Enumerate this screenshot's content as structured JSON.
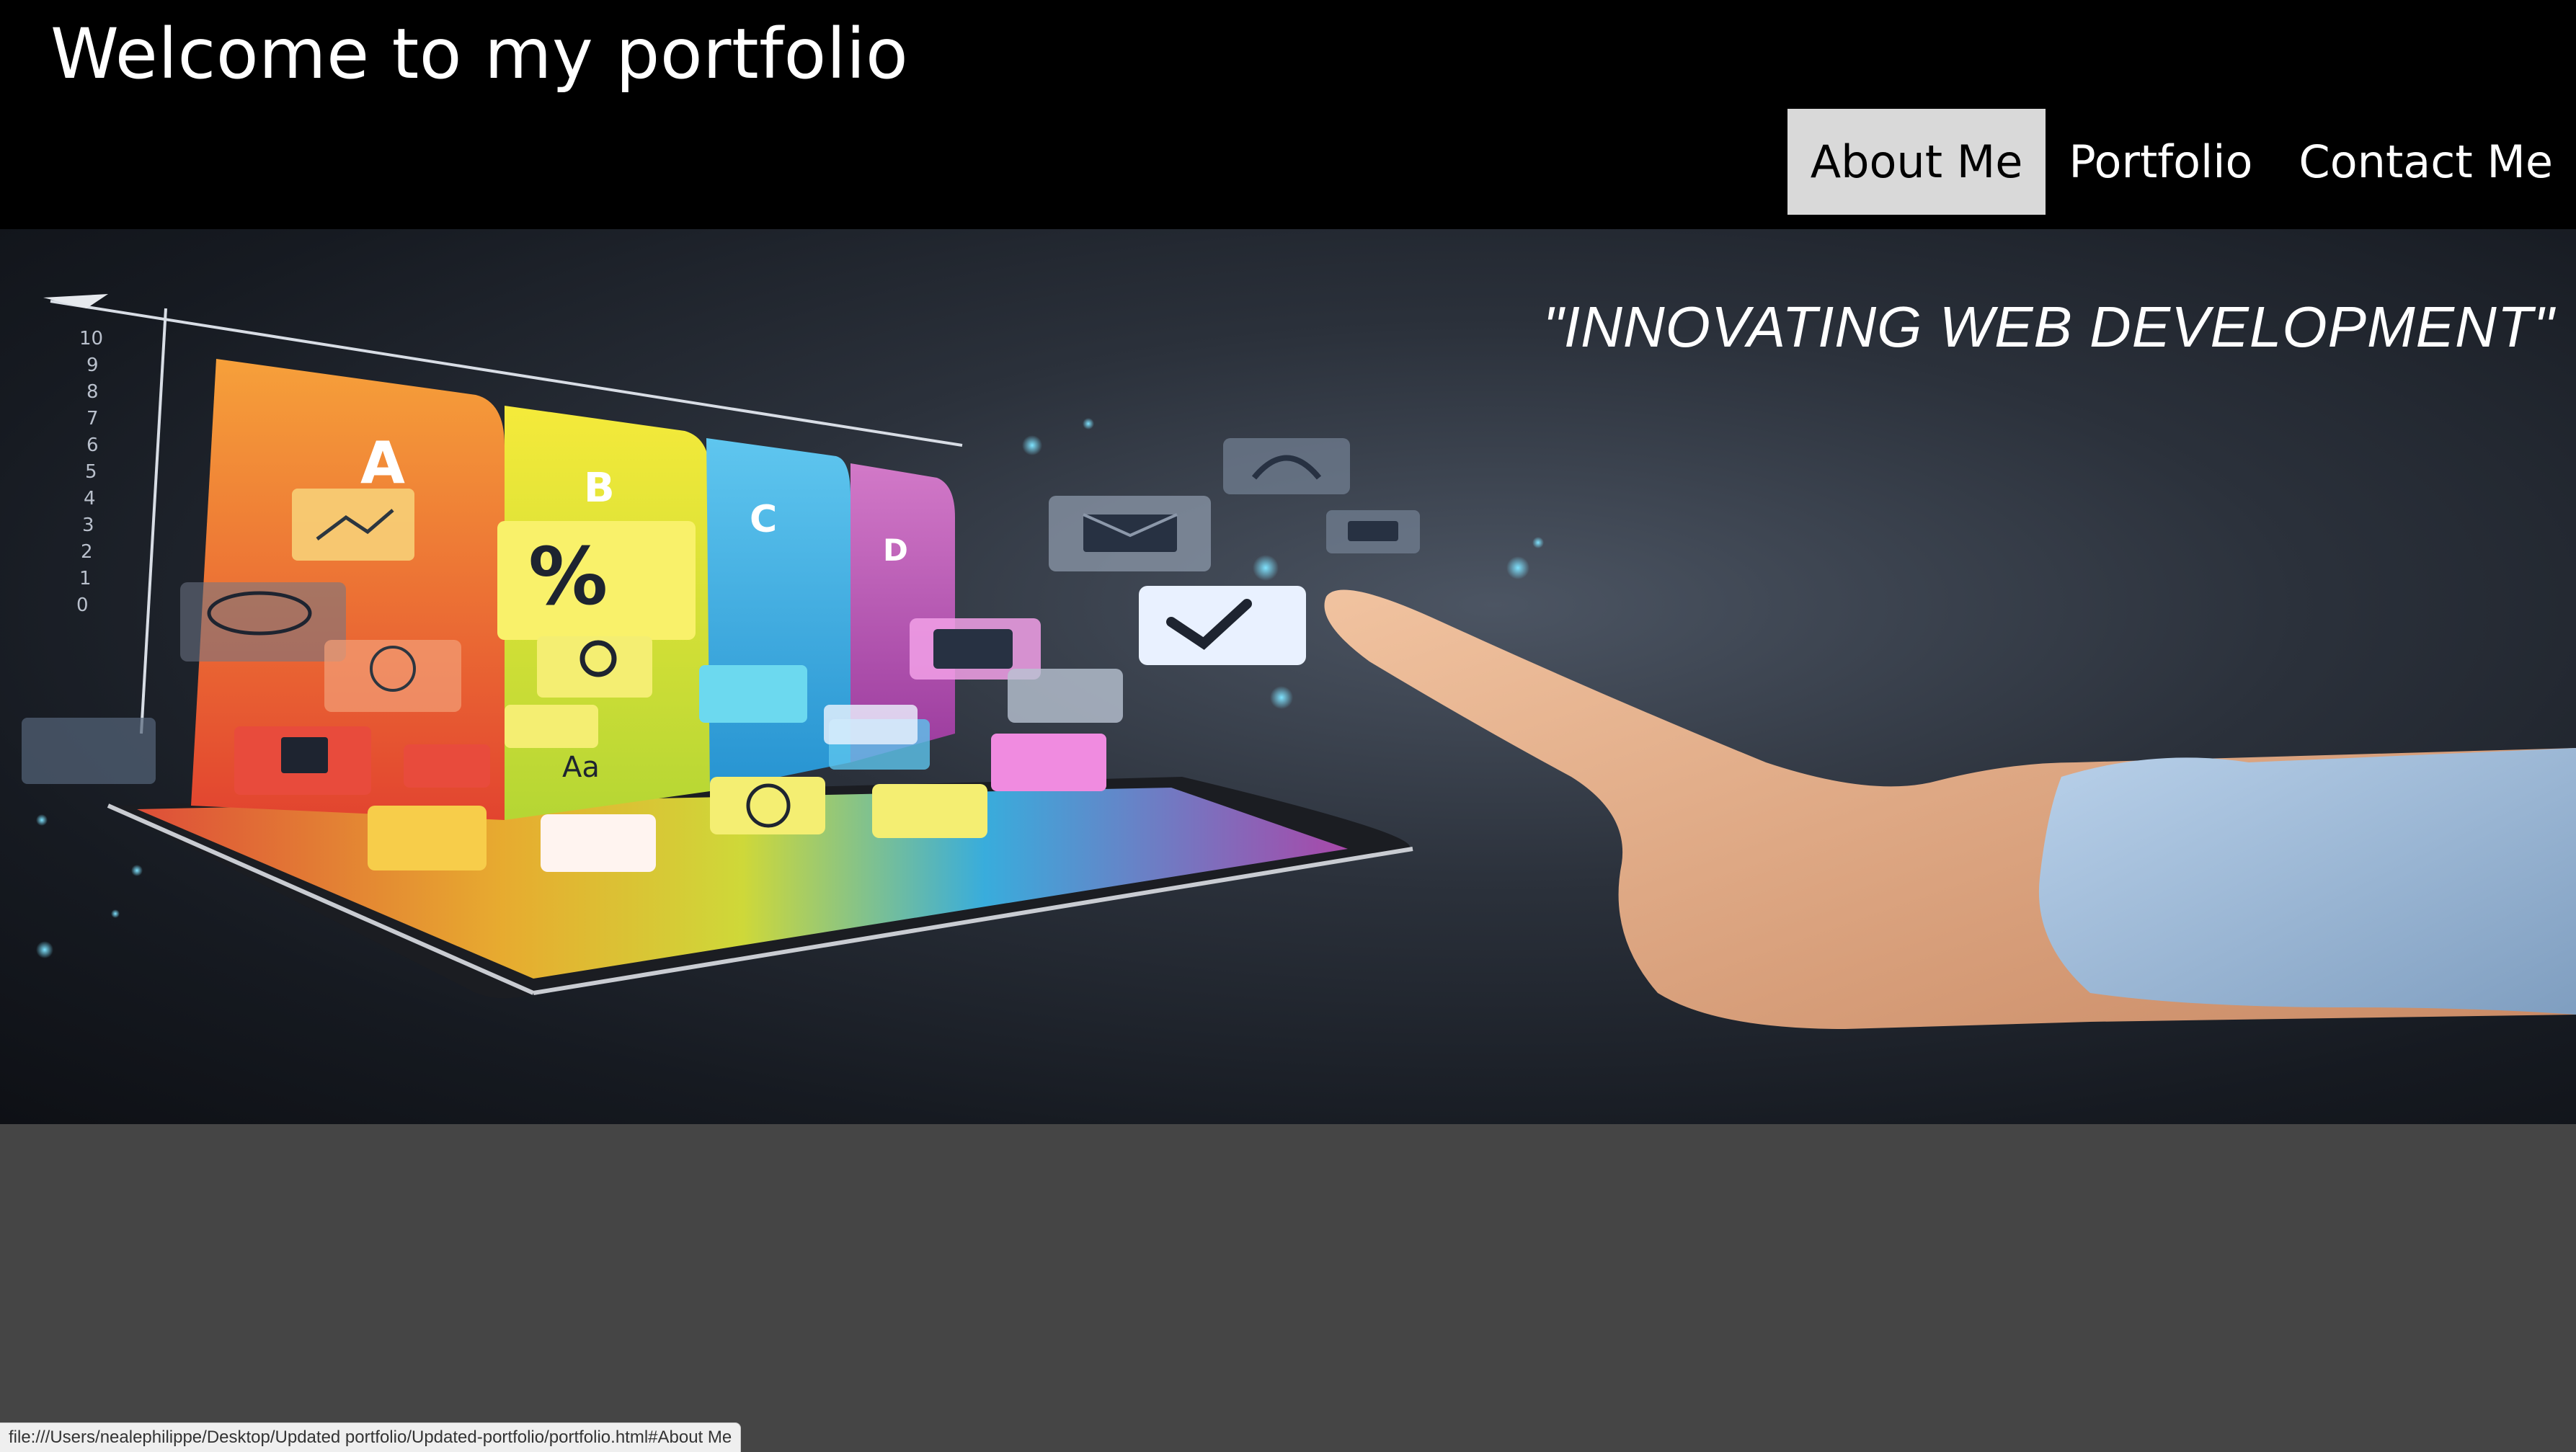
{
  "header": {
    "title": "Welcome to my portfolio",
    "nav": [
      {
        "label": "About Me",
        "active": true
      },
      {
        "label": "Portfolio",
        "active": false
      },
      {
        "label": "Contact Me",
        "active": false
      }
    ]
  },
  "hero": {
    "tagline": "\"INNOVATING WEB DEVELOPMENT\"",
    "image_subject": "hand pointing at tablet with floating app icons",
    "chart_labels": [
      "A",
      "B",
      "C",
      "D"
    ],
    "axis_ticks": [
      "10",
      "9",
      "8",
      "7",
      "6",
      "5",
      "4",
      "3",
      "2",
      "1",
      "0"
    ],
    "percent_symbol": "%",
    "font_sample": "Aa"
  },
  "status_bar": {
    "url": "file:///Users/nealephilippe/Desktop/Updated portfolio/Updated-portfolio/portfolio.html#About Me"
  },
  "colors": {
    "header_bg": "#000000",
    "nav_active_bg": "#d9d9d9",
    "page_bg": "#454545"
  }
}
